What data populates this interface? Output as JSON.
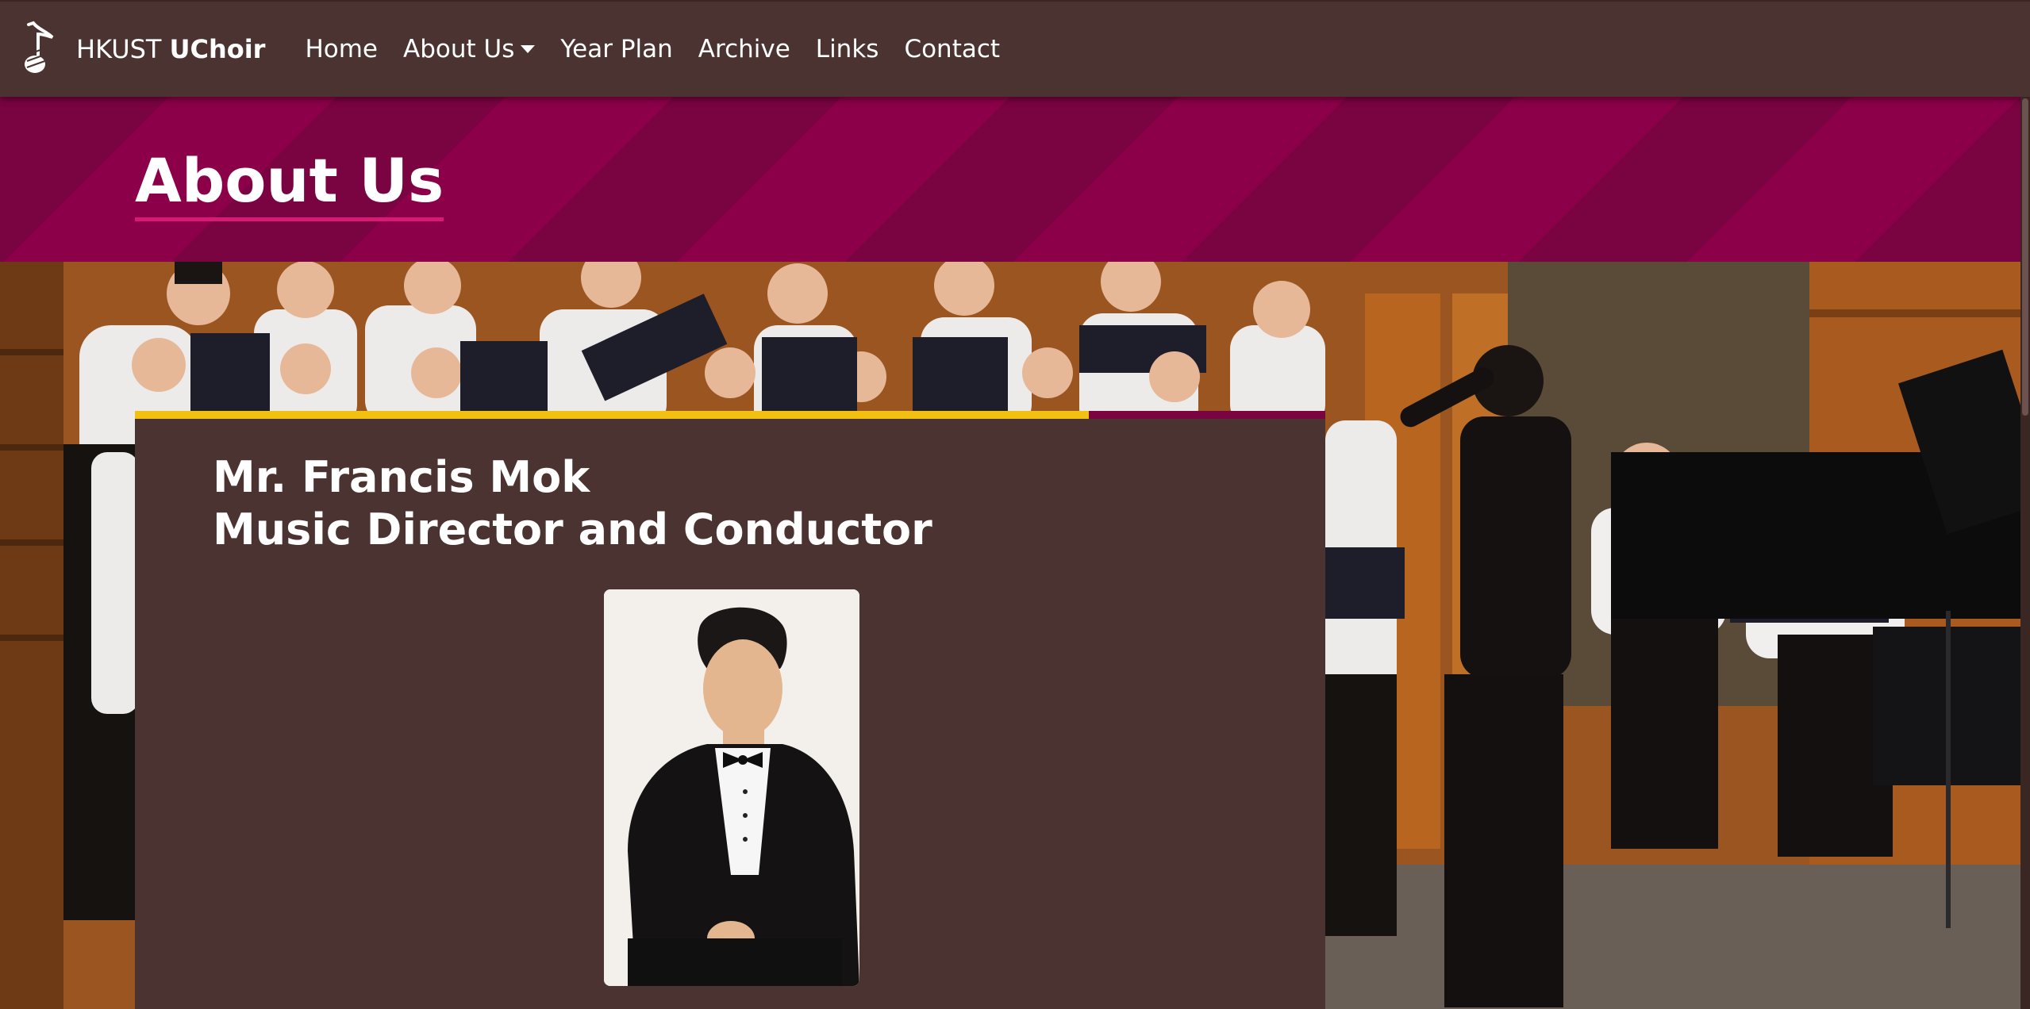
{
  "brand": {
    "prefix": "HKUST",
    "name": "UChoir",
    "icon": "music-note-icon"
  },
  "nav": {
    "home": "Home",
    "about": "About Us",
    "year_plan": "Year Plan",
    "archive": "Archive",
    "links": "Links",
    "contact": "Contact"
  },
  "banner": {
    "title": "About Us"
  },
  "profile": {
    "name": "Mr. Francis Mok",
    "role": "Music Director and Conductor"
  },
  "colors": {
    "nav_bg": "#4a3330",
    "banner_stripe_a": "#7a0341",
    "banner_stripe_b": "#8c0049",
    "title_underline": "#d71a74",
    "card_accent": "#f2c010",
    "card_accent_secondary": "#7a0341"
  }
}
